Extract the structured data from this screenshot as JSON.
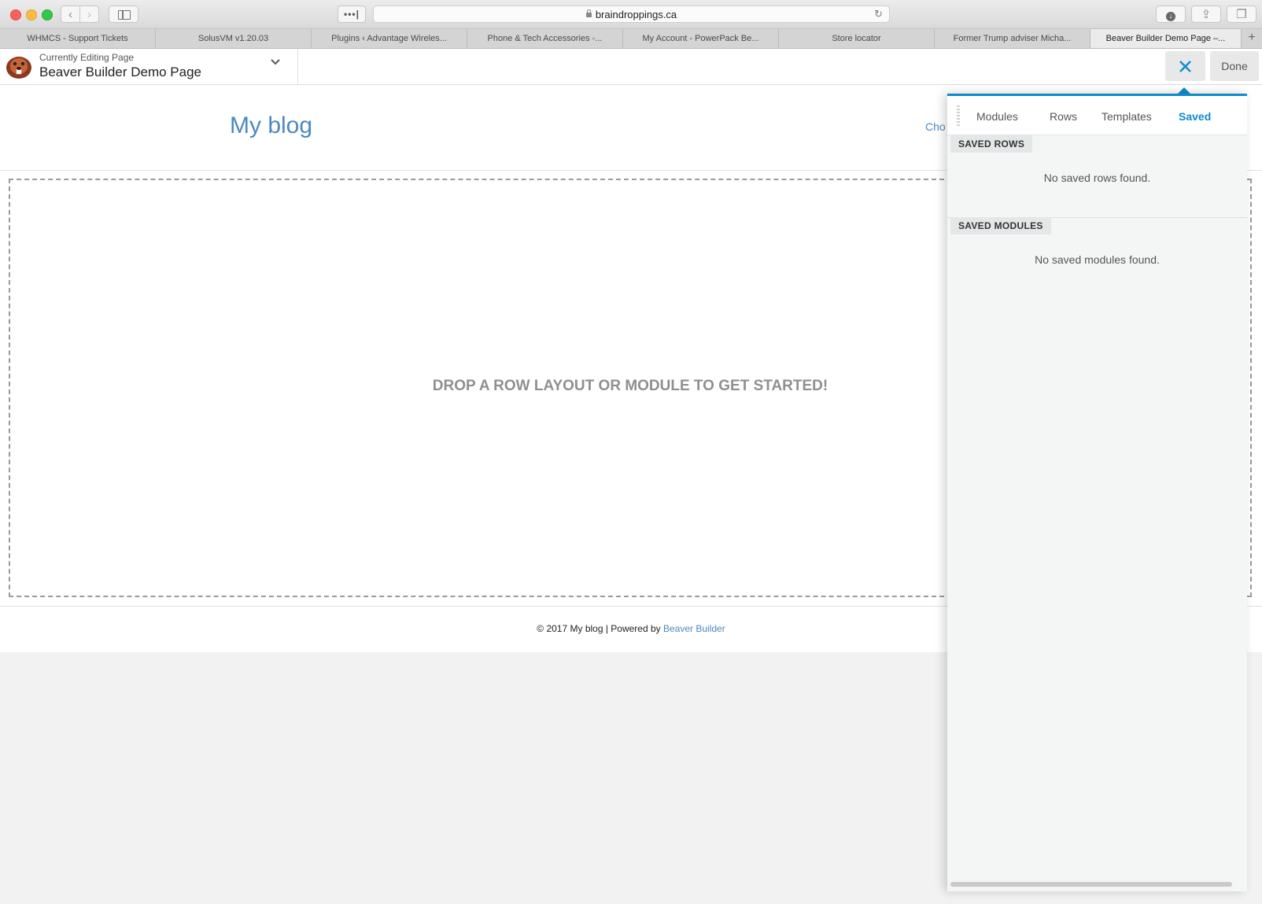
{
  "browser": {
    "url": "braindroppings.ca",
    "tabs": [
      {
        "label": "WHMCS - Support Tickets"
      },
      {
        "label": "SolusVM v1.20.03"
      },
      {
        "label": "Plugins ‹ Advantage Wireles..."
      },
      {
        "label": "Phone & Tech Accessories -..."
      },
      {
        "label": "My Account - PowerPack Be..."
      },
      {
        "label": "Store locator"
      },
      {
        "label": "Former Trump adviser Micha..."
      },
      {
        "label": "Beaver Builder Demo Page –..."
      }
    ],
    "active_tab_index": 7,
    "more_label": "•••|",
    "add_tab_label": "+"
  },
  "builder_bar": {
    "editing_label": "Currently Editing Page",
    "page_title": "Beaver Builder Demo Page",
    "done_label": "Done"
  },
  "site": {
    "title": "My blog",
    "header_link": "Cho",
    "drop_text": "DROP A ROW LAYOUT OR MODULE TO GET STARTED!",
    "footer_text": "© 2017 My blog | Powered by ",
    "footer_link": "Beaver Builder"
  },
  "panel": {
    "tabs": [
      {
        "label": "Modules"
      },
      {
        "label": "Rows"
      },
      {
        "label": "Templates"
      },
      {
        "label": "Saved"
      }
    ],
    "active_tab": "Saved",
    "saved_rows_label": "SAVED ROWS",
    "saved_rows_empty": "No saved rows found.",
    "saved_modules_label": "SAVED MODULES",
    "saved_modules_empty": "No saved modules found."
  },
  "colors": {
    "accent": "#0e8bcc",
    "link": "#4a89c2"
  }
}
